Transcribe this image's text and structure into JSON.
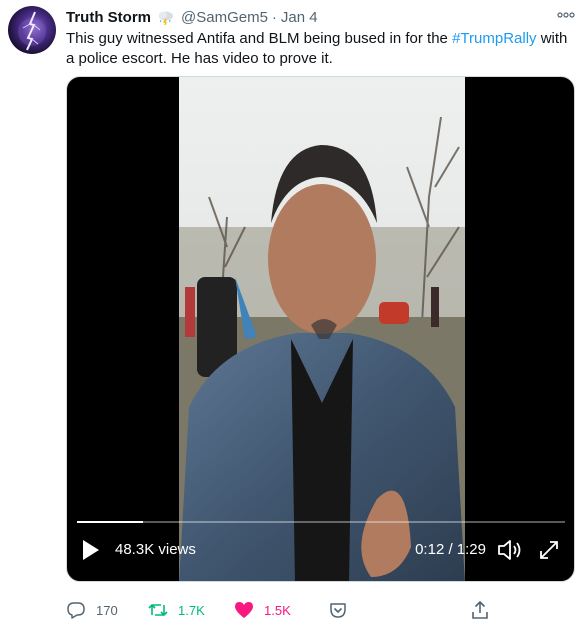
{
  "tweet": {
    "display_name": "Truth Storm",
    "handle": "@SamGem5",
    "separator": "·",
    "date": "Jan 4",
    "text_before": "This guy witnessed Antifa and BLM being bused in for the ",
    "hashtag": "#TrumpRally",
    "text_after": "  with a police escort. He has video to prove it."
  },
  "video": {
    "views": "48.3K views",
    "time": "0:12 / 1:29",
    "progress": 0.135
  },
  "actions": {
    "replies": "170",
    "retweets": "1.7K",
    "likes": "1.5K"
  },
  "colors": {
    "hashtag": "#1d9bf0",
    "retweet": "#00ba7c",
    "like": "#f91880",
    "muted": "#536471"
  }
}
